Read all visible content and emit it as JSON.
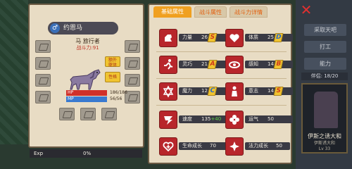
{
  "character": {
    "name": "约恩马",
    "race_job": "马 旅行者",
    "power_label": "战斗力:91",
    "hp_label": "HP",
    "hp_value": "186/186",
    "hp_fraction": 1.0,
    "mp_label": "MP",
    "mp_value": "56/56",
    "mp_fraction": 1.0,
    "buttons": {
      "extra_body": "额外\n躯体",
      "talent": "性格"
    },
    "exp_label": "Exp",
    "exp_value": "0%"
  },
  "tabs": [
    {
      "label": "基础属性",
      "active": true
    },
    {
      "label": "战斗属性",
      "active": false
    },
    {
      "label": "战斗力详情",
      "active": false
    }
  ],
  "stats": {
    "strength": {
      "label": "力量",
      "value": "26",
      "grade": "S",
      "grade_color": "#d03a1a",
      "icon": "fist-icon"
    },
    "physique": {
      "label": "体质",
      "value": "25",
      "grade": "D",
      "grade_color": "#2a6ac8",
      "icon": "heart-icon"
    },
    "agility": {
      "label": "灵巧",
      "value": "21",
      "grade": "A",
      "grade_color": "#d03a1a",
      "icon": "running-icon"
    },
    "perception": {
      "label": "感知",
      "value": "14",
      "grade": "B",
      "grade_color": "#d03a1a",
      "icon": "eye-icon"
    },
    "magic": {
      "label": "魔力",
      "value": "12",
      "grade": "C",
      "grade_color": "#2a6ac8",
      "icon": "hexagram-icon"
    },
    "willpower": {
      "label": "意志",
      "value": "14",
      "grade": "S",
      "grade_color": "#d03a1a",
      "icon": "figure-icon"
    },
    "speed": {
      "label": "速度",
      "value": "135",
      "bonus": "+40",
      "icon": "speed-icon"
    },
    "luck": {
      "label": "运气",
      "value": "50",
      "icon": "clover-icon"
    },
    "life_growth": {
      "label": "生命成长",
      "value": "70",
      "icon": "heart-plus-icon"
    },
    "mana_growth": {
      "label": "法力成长",
      "value": "50",
      "icon": "mana-icon"
    }
  },
  "sidebar": {
    "buttons": [
      "采取天吧",
      "打工",
      "能力"
    ],
    "counter": "伴侣: 18/20",
    "portrait_name": "伊斯之诱大和",
    "portrait_sub": "伊斯诱大和\nLv 33"
  },
  "colors": {
    "accent": "#f0a020",
    "stat_icon": "#b8262b",
    "grade_gold": "#f0c430"
  }
}
